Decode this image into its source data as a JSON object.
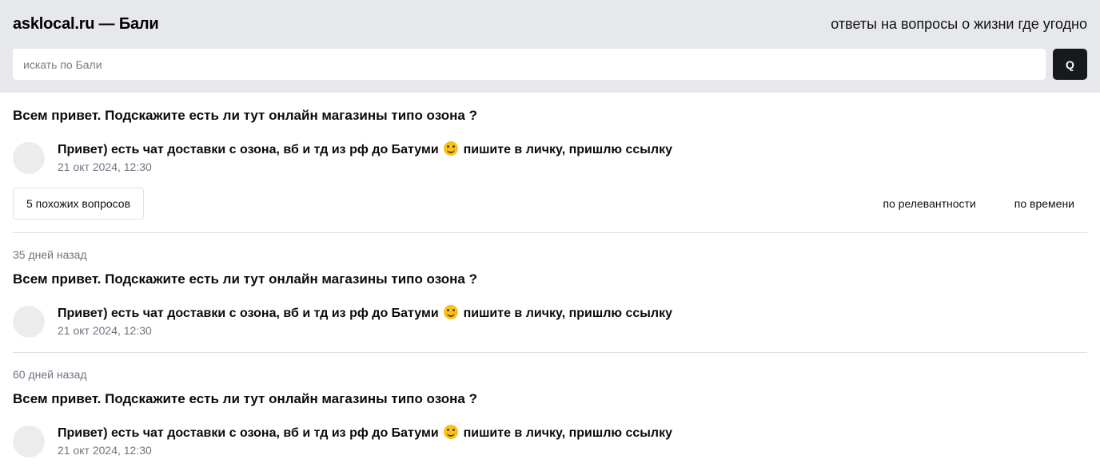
{
  "header": {
    "site_title": "asklocal.ru — Бали",
    "tagline": "ответы на вопросы о жизни где угодно",
    "search_placeholder": "искать по Бали",
    "search_button_label": "Q"
  },
  "main_question": {
    "title": "Всем привет. Подскажите есть ли тут онлайн магазины типо озона ?",
    "answer": {
      "text_before": "Привет) есть чат доставки с озона, вб и тд из рф до Батуми",
      "emoji": "smiling-face-icon",
      "text_after": "пишите в личку, пришлю ссылку",
      "date": "21 окт 2024, 12:30"
    }
  },
  "toolbar": {
    "similar_label": "5 похожих вопросов",
    "sort_relevance_label": "по релевантности",
    "sort_time_label": "по времени"
  },
  "similar": [
    {
      "ago": "35 дней назад",
      "title": "Всем привет. Подскажите есть ли тут онлайн магазины типо озона ?",
      "answer_before": "Привет) есть чат доставки с озона, вб и тд из рф до Батуми",
      "answer_after": "пишите в личку, пришлю ссылку",
      "date": "21 окт 2024, 12:30"
    },
    {
      "ago": "60 дней назад",
      "title": "Всем привет. Подскажите есть ли тут онлайн магазины типо озона ?",
      "answer_before": "Привет) есть чат доставки с озона, вб и тд из рф до Батуми",
      "answer_after": "пишите в личку, пришлю ссылку",
      "date": "21 окт 2024, 12:30"
    }
  ],
  "colors": {
    "header_bg": "#e6e8ec",
    "search_button_bg": "#17191c",
    "muted_text": "#6e7480",
    "divider": "#dcdee2"
  }
}
